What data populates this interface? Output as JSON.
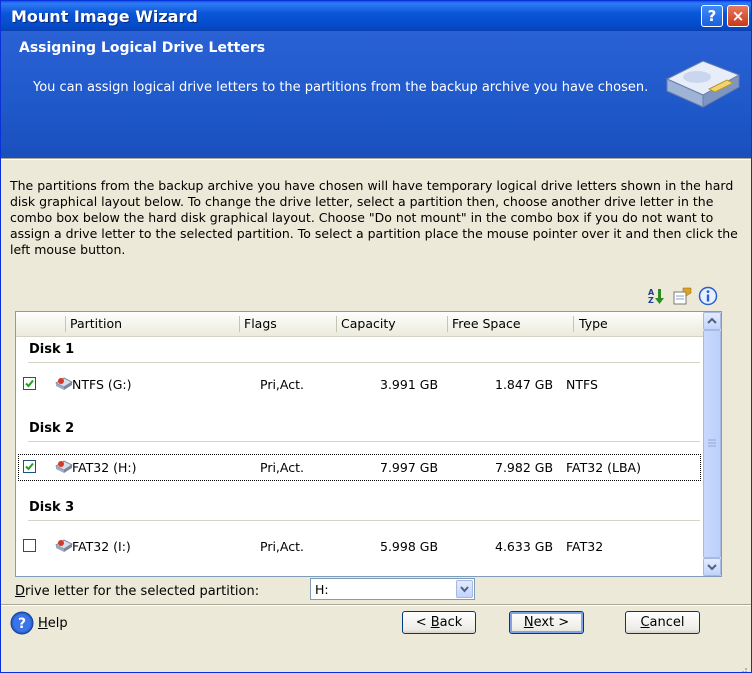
{
  "window": {
    "title": "Mount Image Wizard",
    "help_glyph": "?",
    "close_glyph": "×"
  },
  "header": {
    "title": "Assigning Logical Drive Letters",
    "subtitle": "You can assign logical drive letters to the partitions from the backup archive you have chosen.",
    "icon": "drive-icon"
  },
  "description": "The partitions from the backup archive you have chosen will have temporary logical drive letters shown in the hard disk graphical layout below. To change the drive letter, select a partition then, choose another drive letter in the combo box below the hard disk graphical layout. Choose \"Do not mount\" in the combo box if you do not want to assign a drive letter to the selected partition. To select a partition place the mouse pointer over it and then click the left mouse button.",
  "toolbar": {
    "icons": [
      "sort-icon",
      "properties-icon",
      "info-icon"
    ]
  },
  "list": {
    "columns": [
      "Partition",
      "Flags",
      "Capacity",
      "Free Space",
      "Type"
    ],
    "groups": [
      {
        "label": "Disk 1",
        "rows": [
          {
            "checked": true,
            "partition": "NTFS (G:)",
            "flags": "Pri,Act.",
            "capacity": "3.991 GB",
            "free_space": "1.847 GB",
            "type": "NTFS"
          }
        ]
      },
      {
        "label": "Disk 2",
        "rows": [
          {
            "checked": true,
            "selected": true,
            "partition": "FAT32 (H:)",
            "flags": "Pri,Act.",
            "capacity": "7.997 GB",
            "free_space": "7.982 GB",
            "type": "FAT32 (LBA)"
          }
        ]
      },
      {
        "label": "Disk 3",
        "rows": [
          {
            "checked": false,
            "partition": "FAT32 (I:)",
            "flags": "Pri,Act.",
            "capacity": "5.998 GB",
            "free_space": "4.633 GB",
            "type": "FAT32"
          }
        ]
      }
    ]
  },
  "drive_letter": {
    "label_mnemonic": "D",
    "label_rest": "rive letter for the selected partition:",
    "value": "H:"
  },
  "footer": {
    "help": {
      "mnemonic": "H",
      "rest": "elp"
    },
    "back": {
      "prefix": "< ",
      "mnemonic": "B",
      "rest": "ack"
    },
    "next": {
      "mnemonic": "N",
      "rest": "ext >"
    },
    "cancel": {
      "mnemonic": "C",
      "rest": "ancel"
    }
  }
}
